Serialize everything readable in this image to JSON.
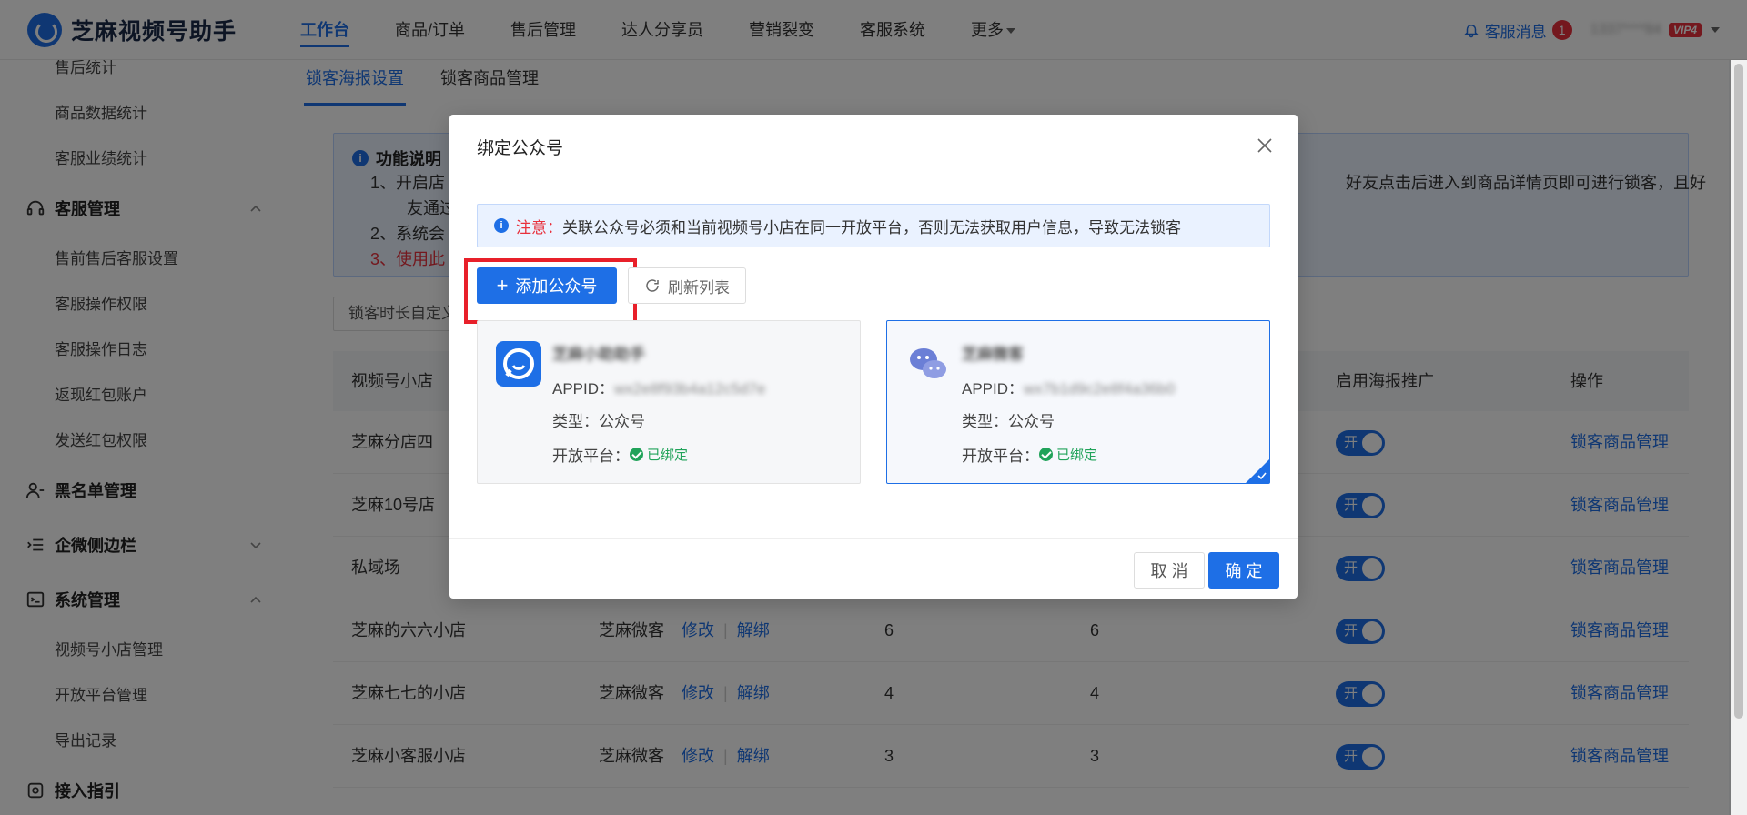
{
  "brand": {
    "name": "芝麻视频号助手"
  },
  "nav": {
    "items": [
      "工作台",
      "商品/订单",
      "售后管理",
      "达人分享员",
      "营销裂变",
      "客服系统",
      "更多"
    ],
    "active_index": 0
  },
  "header_right": {
    "message_label": "客服消息",
    "message_count": "1",
    "user": "1337****84",
    "vip": "VIP4"
  },
  "sidebar": {
    "items_top": [
      "售后统计",
      "商品数据统计",
      "客服业绩统计"
    ],
    "group_service": "客服管理",
    "items_service": [
      "售前售后客服设置",
      "客服操作权限",
      "客服操作日志",
      "返现红包账户",
      "发送红包权限"
    ],
    "group_blacklist": "黑名单管理",
    "group_wecom": "企微侧边栏",
    "group_system": "系统管理",
    "items_system": [
      "视频号小店管理",
      "开放平台管理",
      "导出记录"
    ],
    "group_access": "接入指引"
  },
  "main": {
    "tabs": [
      "锁客海报设置",
      "锁客商品管理"
    ],
    "notice": {
      "title": "功能说明",
      "line1_start": "1、开启店",
      "line1_end": "好友点击后进入到商品详情页即可进行锁客，且好",
      "line1_wrap": "友通过",
      "line2": "2、系统会",
      "line3": "3、使用此"
    },
    "filter_label": "锁客时长自定义",
    "table": {
      "headers": {
        "shop": "视频号小店",
        "poster": "启用海报推广",
        "action": "操作"
      },
      "rows": [
        {
          "shop": "芝麻分店四",
          "switch": "开",
          "action": "锁客商品管理"
        },
        {
          "shop": "芝麻10号店",
          "switch": "开",
          "action": "锁客商品管理"
        },
        {
          "shop": "私域场",
          "switch": "开",
          "action": "锁客商品管理"
        },
        {
          "shop": "芝麻的六六小店",
          "account": "芝麻微客",
          "edit": "修改",
          "unbind": "解绑",
          "n1": "6",
          "n2": "6",
          "switch": "开",
          "action": "锁客商品管理"
        },
        {
          "shop": "芝麻七七的小店",
          "account": "芝麻微客",
          "edit": "修改",
          "unbind": "解绑",
          "n1": "4",
          "n2": "4",
          "switch": "开",
          "action": "锁客商品管理"
        },
        {
          "shop": "芝麻小客服小店",
          "account": "芝麻微客",
          "edit": "修改",
          "unbind": "解绑",
          "n1": "3",
          "n2": "3",
          "switch": "开",
          "action": "锁客商品管理"
        }
      ]
    }
  },
  "modal": {
    "title": "绑定公众号",
    "alert_prefix": "注意：",
    "alert_text": "关联公众号必须和当前视频号小店在同一开放平台，否则无法获取用户信息，导致无法锁客",
    "add_button": "添加公众号",
    "refresh_button": "刷新列表",
    "cards": [
      {
        "name": "芝麻小助助手",
        "appid_label": "APPID：",
        "appid": "wx2e8f93b4a12c5d7e",
        "type_label": "类型：",
        "type": "公众号",
        "platform_label": "开放平台：",
        "platform_status": "已绑定",
        "selected": false
      },
      {
        "name": "芝麻微客",
        "appid_label": "APPID：",
        "appid": "wx7b1d9c2e8f4a36b0",
        "type_label": "类型：",
        "type": "公众号",
        "platform_label": "开放平台：",
        "platform_status": "已绑定",
        "selected": true
      }
    ],
    "cancel": "取 消",
    "confirm": "确 定"
  },
  "colors": {
    "primary": "#1e6fe6",
    "danger": "#e8303c",
    "success": "#21a35a"
  }
}
